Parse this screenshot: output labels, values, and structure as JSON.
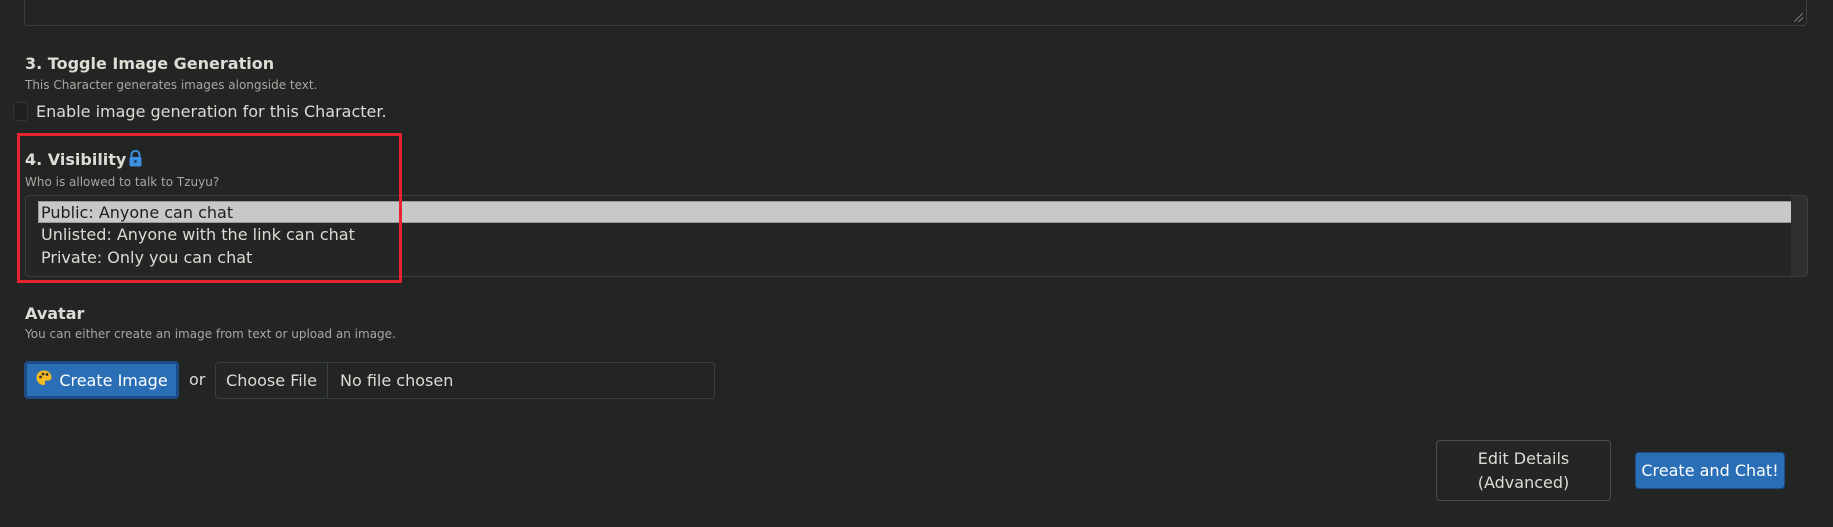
{
  "section3": {
    "title": "3. Toggle Image Generation",
    "description": "This Character generates images alongside text.",
    "checkbox_label": "Enable image generation for this Character.",
    "checked": false
  },
  "section4": {
    "title": "4. Visibility",
    "title_icon": "lock-icon",
    "description": "Who is allowed to talk to Tzuyu?",
    "options": [
      {
        "label": "Public: Anyone can chat",
        "selected": true
      },
      {
        "label": "Unlisted: Anyone with the link can chat",
        "selected": false
      },
      {
        "label": "Private: Only you can chat",
        "selected": false
      }
    ],
    "highlight_color": "#e3232e"
  },
  "avatar": {
    "title": "Avatar",
    "description": "You can either create an image from text or upload an image.",
    "create_image_label": "Create Image",
    "create_image_icon": "palette-icon",
    "or_text": "or",
    "choose_file_label": "Choose File",
    "no_file_text": "No file chosen"
  },
  "footer": {
    "edit_details_label": "Edit Details\n(Advanced)",
    "create_chat_label": "Create and Chat!"
  },
  "colors": {
    "background": "#232524",
    "accent": "#2a6fb5",
    "text": "#dedbd5",
    "muted": "#a8a6a0"
  }
}
